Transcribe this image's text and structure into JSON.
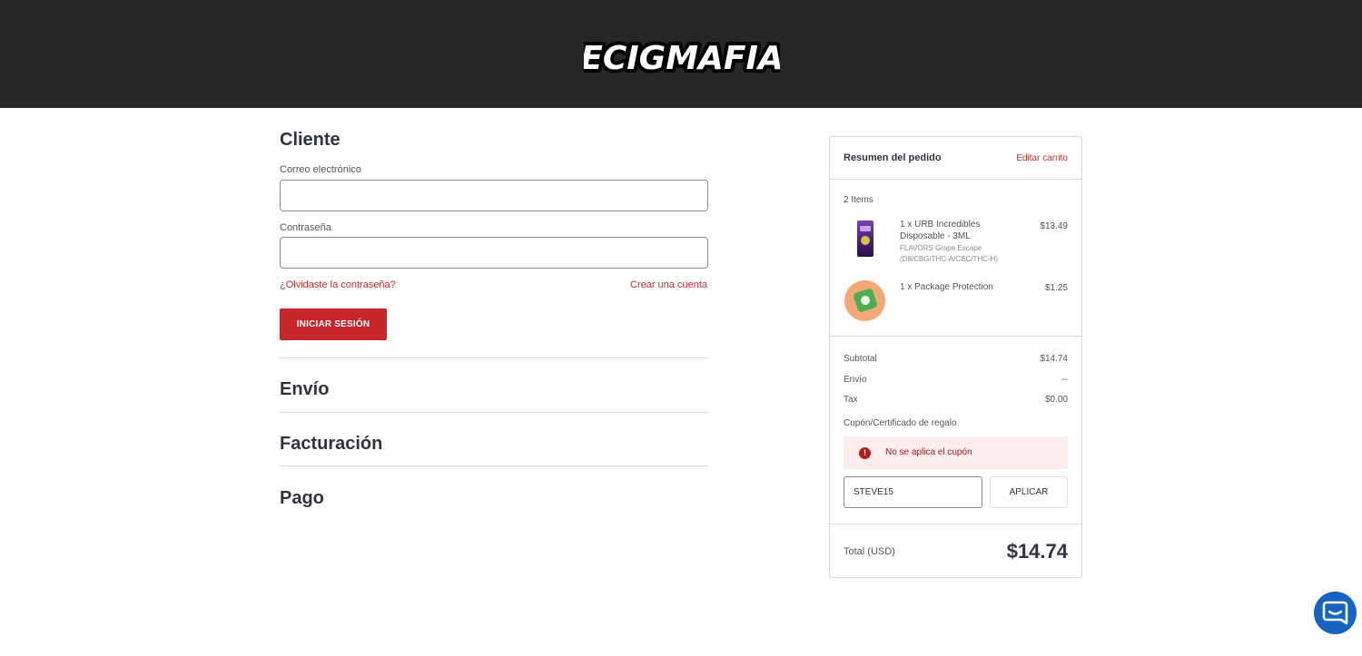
{
  "brand": {
    "logo_text": "ECIGMAFIA",
    "accent_color": "#c8272a",
    "header_color": "#262626"
  },
  "customer": {
    "title": "Cliente",
    "email_label": "Correo electrónico",
    "email_value": "",
    "password_label": "Contraseña",
    "password_value": "",
    "forgot_link": "¿Olvidaste la contraseña?",
    "create_account_link": "Crear una cuenta",
    "login_button": "INICIAR SESIÓN"
  },
  "sections": {
    "shipping": "Envío",
    "billing": "Facturación",
    "payment": "Pago"
  },
  "summary": {
    "title": "Resumen del pedido",
    "edit_cart": "Editar carrito",
    "items_count": "2 Items",
    "items": [
      {
        "name": "1 x URB Incredibles Disposable - 3ML",
        "option": "FLAVORS Grape Escape (D8/CBG/THC-A/CBC/THC-H)",
        "price": "$13.49",
        "image_icon": "vape-product-image"
      },
      {
        "name": "1 x Package Protection",
        "option": "",
        "price": "$1.25",
        "image_icon": "package-protection-image"
      }
    ],
    "subtotal_label": "Subtotal",
    "subtotal_value": "$14.74",
    "shipping_label": "Envío",
    "shipping_value": "--",
    "tax_label": "Tax",
    "tax_value": "$0.00",
    "coupon_label": "Cupón/Certificado de regalo",
    "coupon_error": "No se aplica el cupón",
    "coupon_value": "STEVE15",
    "apply_button": "APLICAR",
    "total_label": "Total (USD)",
    "total_value": "$14.74"
  },
  "chat": {
    "icon": "chat-icon"
  }
}
